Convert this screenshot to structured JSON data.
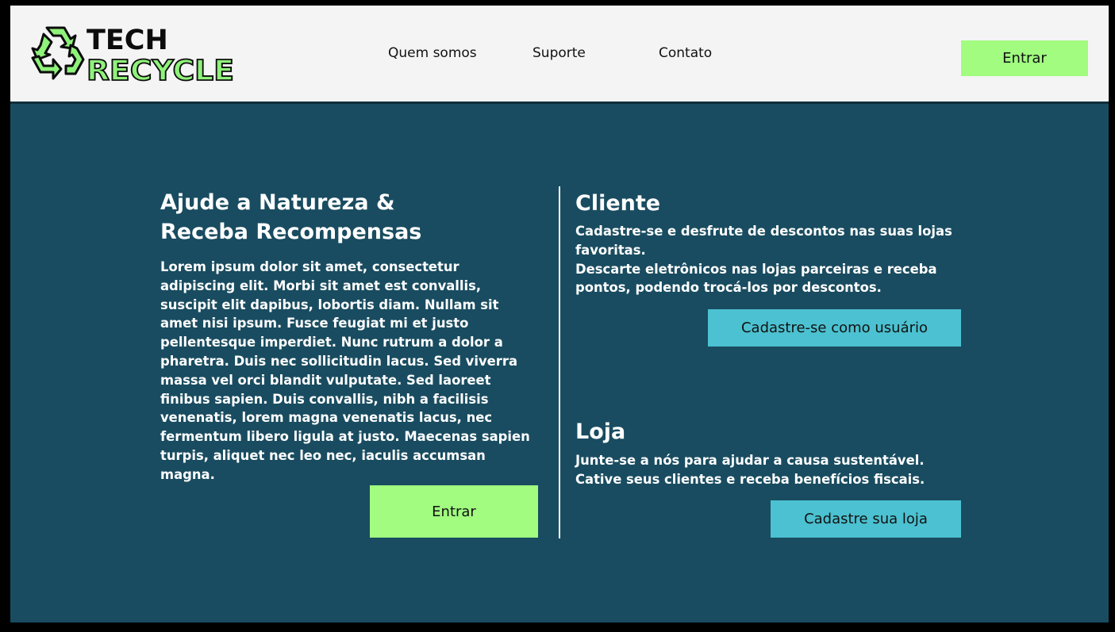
{
  "brand": {
    "name_line1": "TECH",
    "name_line2": "RECYCLE",
    "colors": {
      "logo_green": "#8ff27a",
      "logo_outline": "#0c0c0c"
    }
  },
  "nav": {
    "links": [
      {
        "label": "Quem somos"
      },
      {
        "label": "Suporte"
      },
      {
        "label": "Contato"
      }
    ],
    "login_label": "Entrar"
  },
  "hero": {
    "title_line1": "Ajude a Natureza &",
    "title_line2": "Receba Recompensas",
    "body": "Lorem ipsum dolor sit amet, consectetur adipiscing elit. Morbi sit amet est convallis, suscipit elit dapibus, lobortis diam. Nullam sit amet nisi ipsum. Fusce feugiat mi et justo pellentesque imperdiet. Nunc rutrum a dolor a pharetra. Duis nec sollicitudin lacus. Sed viverra massa vel orci blandit vulputate. Sed laoreet finibus sapien. Duis convallis, nibh a facilisis venenatis, lorem magna venenatis lacus, nec fermentum libero ligula at justo. Maecenas sapien turpis, aliquet nec leo nec, iaculis accumsan magna.",
    "cta_label": "Entrar"
  },
  "cliente": {
    "title": "Cliente",
    "line1": "Cadastre-se e desfrute de descontos nas suas lojas favoritas.",
    "line2": "Descarte eletrônicos nas lojas parceiras e receba pontos, podendo trocá-los por descontos.",
    "cta_label": "Cadastre-se como usuário"
  },
  "loja": {
    "title": "Loja",
    "text": "Junte-se a nós para ajudar a causa sustentável. Cative seus clientes e receba benefícios fiscais.",
    "cta_label": "Cadastre sua loja"
  },
  "colors": {
    "page_background": "#194c60",
    "header_background": "#f4f4f4",
    "primary_button": "#a1fc80",
    "secondary_button": "#4bc1d1",
    "text_light": "#ffffff"
  }
}
